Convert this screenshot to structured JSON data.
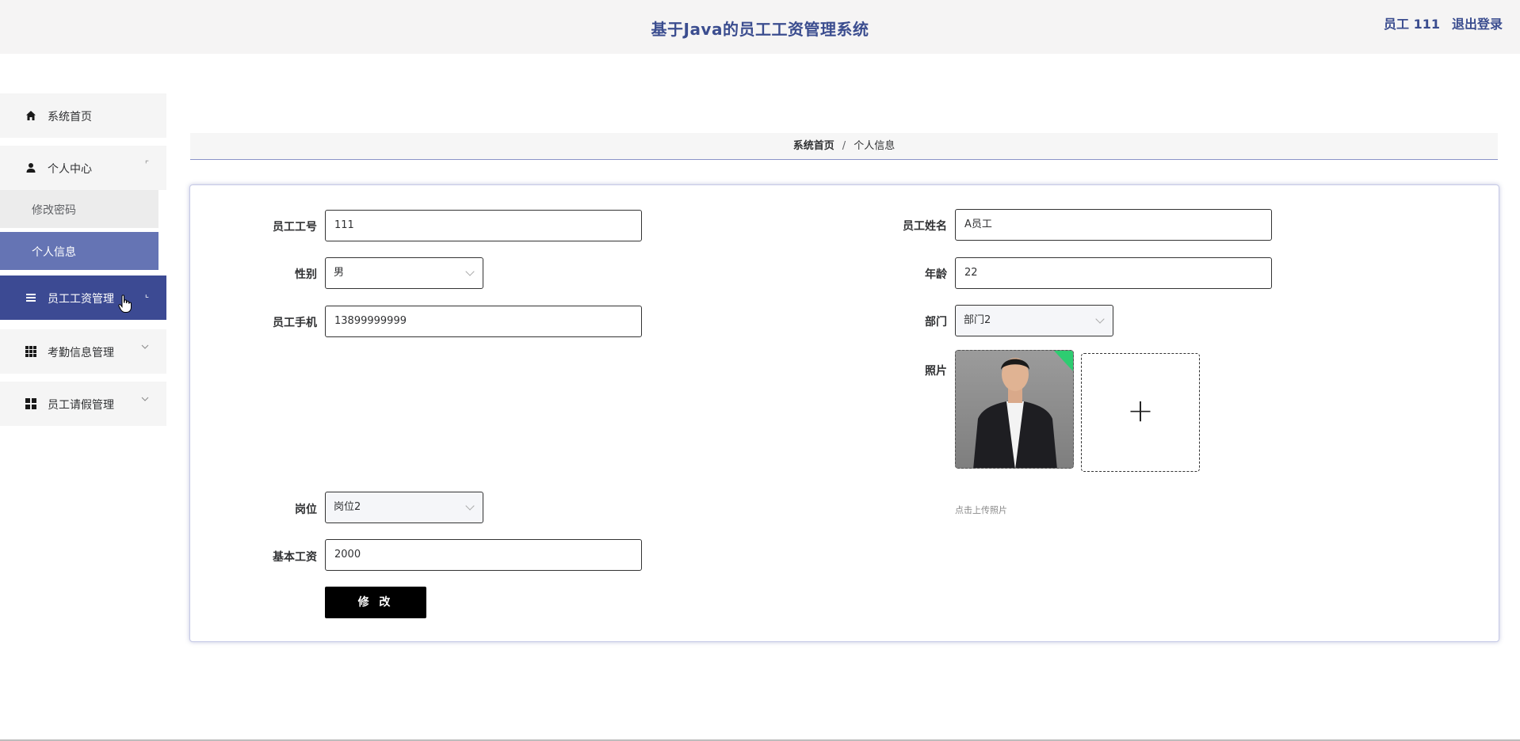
{
  "header": {
    "title": "基于Java的员工工资管理系统",
    "user": "员工 111",
    "logout": "退出登录"
  },
  "sidebar": {
    "items": [
      {
        "label": "系统首页",
        "icon": "home-icon"
      },
      {
        "label": "个人中心",
        "icon": "user-icon",
        "arrow": "⌜"
      },
      {
        "label": "员工工资管理",
        "icon": "list-icon",
        "arrow": "⌞"
      },
      {
        "label": "考勤信息管理",
        "icon": "grid-icon"
      },
      {
        "label": "员工请假管理",
        "icon": "apps-icon"
      }
    ],
    "sub": [
      {
        "label": "修改密码"
      },
      {
        "label": "个人信息"
      }
    ]
  },
  "breadcrumb": {
    "home": "系统首页",
    "sep": "/",
    "current": "个人信息"
  },
  "form": {
    "emp_no_label": "员工工号",
    "emp_no": "111",
    "emp_name_label": "员工姓名",
    "emp_name": "A员工",
    "gender_label": "性别",
    "gender": "男",
    "age_label": "年龄",
    "age": "22",
    "phone_label": "员工手机",
    "phone": "13899999999",
    "dept_label": "部门",
    "dept": "部门2",
    "photo_label": "照片",
    "photo_hint": "点击上传照片",
    "post_label": "岗位",
    "post": "岗位2",
    "salary_label": "基本工资",
    "salary": "2000",
    "submit": "修 改"
  },
  "colors": {
    "accent": "#3c4a93",
    "accent_light": "#6574b4",
    "title": "#3b4d8f"
  }
}
